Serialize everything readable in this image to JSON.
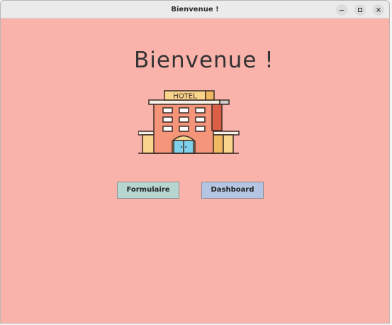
{
  "window": {
    "title": "Bienvenue !",
    "controls": [
      "minimize-icon",
      "maximize-icon",
      "close-icon"
    ]
  },
  "main": {
    "heading": "Bienvenue !",
    "illustration": {
      "icon": "hotel-building-icon",
      "sign_text": "HOTEL"
    },
    "buttons": {
      "formulaire": "Formulaire",
      "dashboard": "Dashboard"
    }
  },
  "colors": {
    "background": "#fab3aa",
    "formulaire_button": "#b7d6cf",
    "dashboard_button": "#b3c5e3"
  }
}
